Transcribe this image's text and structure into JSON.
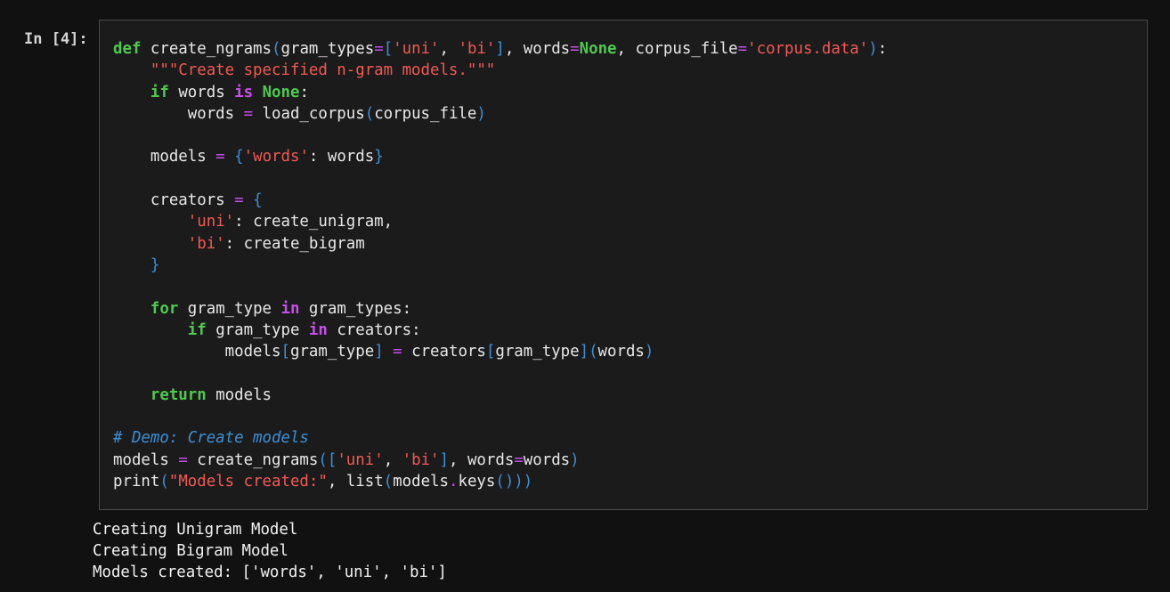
{
  "cell": {
    "prompt": "In [4]:",
    "code_lines": [
      [
        [
          "kw",
          "def"
        ],
        [
          "fn",
          " create_ngrams"
        ],
        [
          "br",
          "("
        ],
        [
          "fn",
          "gram_types"
        ],
        [
          "op",
          "="
        ],
        [
          "br",
          "["
        ],
        [
          "str",
          "'uni'"
        ],
        [
          "fn",
          ", "
        ],
        [
          "str",
          "'bi'"
        ],
        [
          "br",
          "]"
        ],
        [
          "fn",
          ", words"
        ],
        [
          "op",
          "="
        ],
        [
          "const",
          "None"
        ],
        [
          "fn",
          ", corpus_file"
        ],
        [
          "op",
          "="
        ],
        [
          "str",
          "'corpus.data'"
        ],
        [
          "br",
          ")"
        ],
        [
          "fn",
          ":"
        ]
      ],
      [
        [
          "fn",
          "    "
        ],
        [
          "str",
          "\"\"\"Create specified n-gram models.\"\"\""
        ]
      ],
      [
        [
          "fn",
          "    "
        ],
        [
          "kw",
          "if"
        ],
        [
          "fn",
          " words "
        ],
        [
          "kw2",
          "is"
        ],
        [
          "fn",
          " "
        ],
        [
          "const",
          "None"
        ],
        [
          "fn",
          ":"
        ]
      ],
      [
        [
          "fn",
          "        words "
        ],
        [
          "op",
          "="
        ],
        [
          "fn",
          " load_corpus"
        ],
        [
          "br",
          "("
        ],
        [
          "fn",
          "corpus_file"
        ],
        [
          "br",
          ")"
        ]
      ],
      [
        [
          "fn",
          ""
        ]
      ],
      [
        [
          "fn",
          "    models "
        ],
        [
          "op",
          "="
        ],
        [
          "fn",
          " "
        ],
        [
          "br",
          "{"
        ],
        [
          "str",
          "'words'"
        ],
        [
          "fn",
          ": words"
        ],
        [
          "br",
          "}"
        ]
      ],
      [
        [
          "fn",
          ""
        ]
      ],
      [
        [
          "fn",
          "    creators "
        ],
        [
          "op",
          "="
        ],
        [
          "fn",
          " "
        ],
        [
          "br",
          "{"
        ]
      ],
      [
        [
          "fn",
          "        "
        ],
        [
          "str",
          "'uni'"
        ],
        [
          "fn",
          ": create_unigram,"
        ]
      ],
      [
        [
          "fn",
          "        "
        ],
        [
          "str",
          "'bi'"
        ],
        [
          "fn",
          ": create_bigram"
        ]
      ],
      [
        [
          "fn",
          "    "
        ],
        [
          "br",
          "}"
        ]
      ],
      [
        [
          "fn",
          ""
        ]
      ],
      [
        [
          "fn",
          "    "
        ],
        [
          "kw",
          "for"
        ],
        [
          "fn",
          " gram_type "
        ],
        [
          "kw2",
          "in"
        ],
        [
          "fn",
          " gram_types:"
        ]
      ],
      [
        [
          "fn",
          "        "
        ],
        [
          "kw",
          "if"
        ],
        [
          "fn",
          " gram_type "
        ],
        [
          "kw2",
          "in"
        ],
        [
          "fn",
          " creators:"
        ]
      ],
      [
        [
          "fn",
          "            models"
        ],
        [
          "br",
          "["
        ],
        [
          "fn",
          "gram_type"
        ],
        [
          "br",
          "]"
        ],
        [
          "fn",
          " "
        ],
        [
          "op",
          "="
        ],
        [
          "fn",
          " creators"
        ],
        [
          "br",
          "["
        ],
        [
          "fn",
          "gram_type"
        ],
        [
          "br",
          "]("
        ],
        [
          "fn",
          "words"
        ],
        [
          "br",
          ")"
        ]
      ],
      [
        [
          "fn",
          ""
        ]
      ],
      [
        [
          "fn",
          "    "
        ],
        [
          "kw",
          "return"
        ],
        [
          "fn",
          " models"
        ]
      ],
      [
        [
          "fn",
          ""
        ]
      ],
      [
        [
          "cmt",
          "# Demo: Create models"
        ]
      ],
      [
        [
          "fn",
          "models "
        ],
        [
          "op",
          "="
        ],
        [
          "fn",
          " create_ngrams"
        ],
        [
          "br",
          "(["
        ],
        [
          "str",
          "'uni'"
        ],
        [
          "fn",
          ", "
        ],
        [
          "str",
          "'bi'"
        ],
        [
          "br",
          "]"
        ],
        [
          "fn",
          ", words"
        ],
        [
          "op",
          "="
        ],
        [
          "fn",
          "words"
        ],
        [
          "br",
          ")"
        ]
      ],
      [
        [
          "fn",
          "print"
        ],
        [
          "br",
          "("
        ],
        [
          "str",
          "\"Models created:\""
        ],
        [
          "fn",
          ", list"
        ],
        [
          "br",
          "("
        ],
        [
          "fn",
          "models"
        ],
        [
          "op",
          "."
        ],
        [
          "fn",
          "keys"
        ],
        [
          "br",
          "()))"
        ]
      ]
    ]
  },
  "output_lines": [
    "Creating Unigram Model",
    "Creating Bigram Model",
    "Models created: ['words', 'uni', 'bi']"
  ],
  "colors": {
    "keyword": "#4ec94e",
    "operator_keyword": "#c74ded",
    "string": "#f05a55",
    "comment": "#3d8fd6",
    "bracket": "#3d8fd6",
    "background": "#111111",
    "cell_background": "#1b1b1b"
  }
}
